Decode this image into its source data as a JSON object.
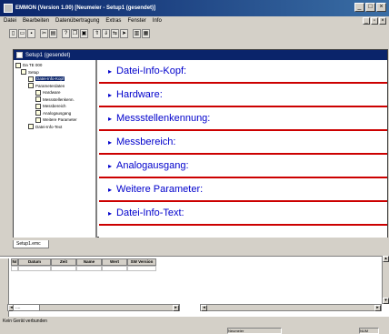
{
  "window": {
    "title": "EMMON (Version 1.00) [Neumeier - Setup1  (gesendet)]",
    "controls": [
      "_",
      "□",
      "×"
    ]
  },
  "menu": {
    "items": [
      "Datei",
      "Bearbeiten",
      "Datenübertragung",
      "Extras",
      "Fenster",
      "Info"
    ]
  },
  "toolbar": {
    "buttons": [
      "new",
      "open",
      "save",
      "cut",
      "print",
      "help",
      "copy",
      "paste",
      "send",
      "receive",
      "compare",
      "b1",
      "b2",
      "b3",
      "b4"
    ]
  },
  "document": {
    "title": "Setup1  (gesendet)",
    "tab": "Setup1.emc"
  },
  "tree": {
    "items": [
      {
        "label": "Setup1  (gesendet)",
        "depth": 0,
        "selected": false
      },
      {
        "label": "Da TE 000",
        "depth": 1,
        "selected": false
      },
      {
        "label": "Setup",
        "depth": 2,
        "selected": false
      },
      {
        "label": "Datei-Info-Kopf",
        "depth": 3,
        "selected": true
      },
      {
        "label": "Parameterdaten",
        "depth": 3,
        "selected": false
      },
      {
        "label": "Hardware",
        "depth": 4,
        "selected": false
      },
      {
        "label": "Messstellenkenn.",
        "depth": 4,
        "selected": false
      },
      {
        "label": "Messbereich",
        "depth": 4,
        "selected": false
      },
      {
        "label": "Analogausgang",
        "depth": 4,
        "selected": false
      },
      {
        "label": "Weitere Parameter",
        "depth": 4,
        "selected": false
      },
      {
        "label": "Datei-Info-Text",
        "depth": 3,
        "selected": false
      }
    ]
  },
  "sections": [
    {
      "label": "Datei-Info-Kopf:"
    },
    {
      "label": "Hardware:"
    },
    {
      "label": "Messstellenkennung:"
    },
    {
      "label": "Messbereich:"
    },
    {
      "label": "Analogausgang:"
    },
    {
      "label": "Weitere Parameter:"
    },
    {
      "label": "Datei-Info-Text:"
    }
  ],
  "bottom_table": {
    "columns": [
      "Nr",
      "Datum",
      "Zeit",
      "Name",
      "Wert",
      "SW Version"
    ],
    "lower_tab": "...."
  },
  "status": {
    "text": "Kein Gerät verbunden",
    "panels": [
      "Neumeier",
      "NUM"
    ]
  },
  "colors": {
    "titlebar_start": "#0a246a",
    "section_text": "#0000cc",
    "section_rule": "#cc0000",
    "chrome": "#d4d0c8"
  }
}
